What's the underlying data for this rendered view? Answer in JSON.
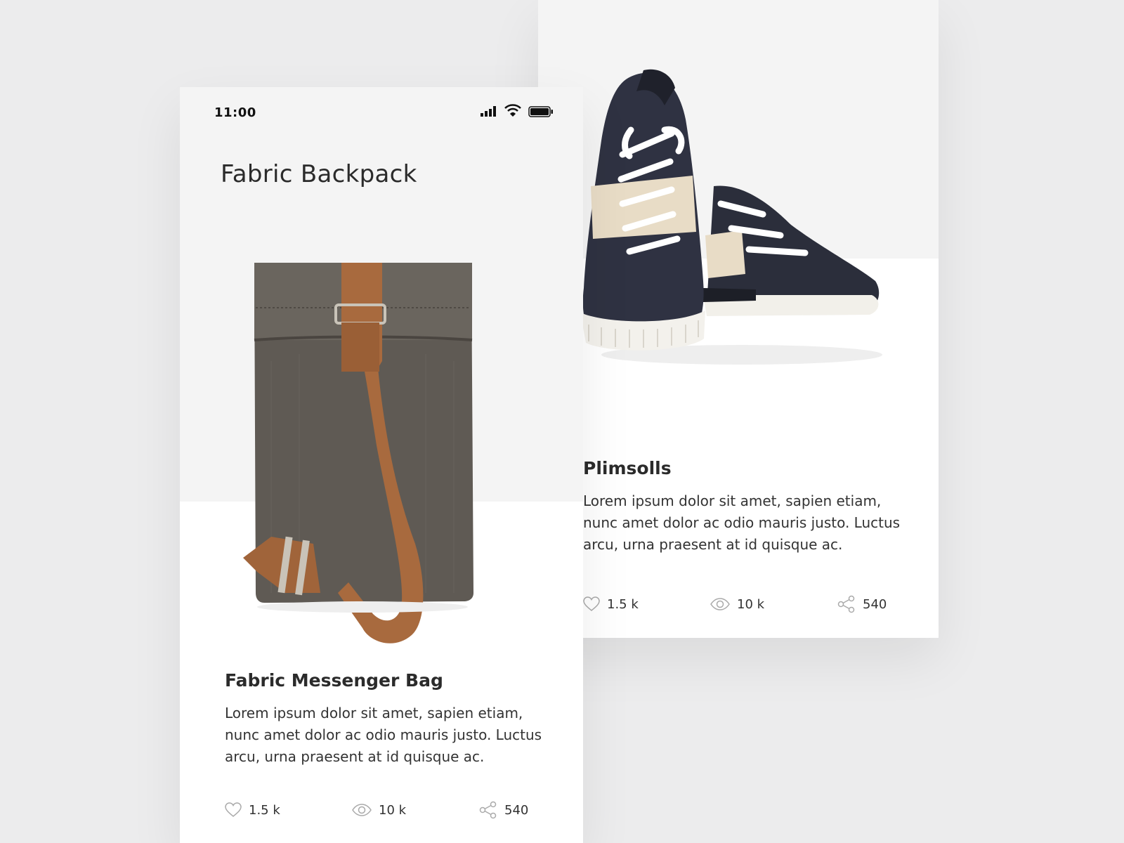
{
  "status_bar": {
    "time": "11:00"
  },
  "page": {
    "title": "Fabric Backpack"
  },
  "cards": {
    "front": {
      "title": "Fabric Messenger Bag",
      "description": "Lorem ipsum dolor sit amet, sapien etiam, nunc amet dolor ac odio mauris justo. Luctus arcu, urna praesent at id quisque ac.",
      "stats": {
        "likes": "1.5 k",
        "views": "10 k",
        "shares": "540"
      }
    },
    "back": {
      "title": "Plimsolls",
      "description": "Lorem ipsum dolor sit amet, sapien etiam, nunc amet dolor ac odio mauris justo. Luctus arcu, urna praesent at id quisque ac.",
      "stats": {
        "likes": "1.5 k",
        "views": "10 k",
        "shares": "540"
      }
    }
  },
  "icons": [
    "signal-icon",
    "wifi-icon",
    "battery-icon",
    "heart-icon",
    "eye-icon",
    "share-icon"
  ],
  "colors": {
    "background": "#ececed",
    "card": "#ffffff",
    "card_top": "#f4f4f4",
    "text": "#333333",
    "strap": "#a86a3e",
    "canvas": "#5f5a54"
  }
}
